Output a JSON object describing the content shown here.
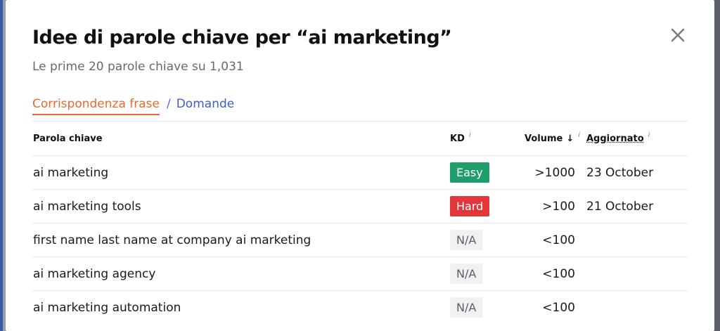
{
  "modal": {
    "title": "Idee di parole chiave per “ai marketing”",
    "subtitle": "Le prime 20 parole chiave su 1,031",
    "close_icon": "close-icon"
  },
  "tabs": {
    "active": "Corrispondenza frase",
    "separator": "/",
    "other": "Domande"
  },
  "table": {
    "headers": {
      "keyword": "Parola chiave",
      "kd": "KD",
      "volume": "Volume",
      "volume_sort_icon": "↓",
      "updated": "Aggiornato",
      "info_icon": "i"
    },
    "rows": [
      {
        "keyword": "ai marketing",
        "kd": "Easy",
        "kd_status": "easy",
        "volume": ">1000",
        "updated": "23 October"
      },
      {
        "keyword": "ai marketing tools",
        "kd": "Hard",
        "kd_status": "hard",
        "volume": ">100",
        "updated": "21 October"
      },
      {
        "keyword": "first name last name at company ai marketing",
        "kd": "N/A",
        "kd_status": "na",
        "volume": "<100",
        "updated": ""
      },
      {
        "keyword": "ai marketing agency",
        "kd": "N/A",
        "kd_status": "na",
        "volume": "<100",
        "updated": ""
      },
      {
        "keyword": "ai marketing automation",
        "kd": "N/A",
        "kd_status": "na",
        "volume": "<100",
        "updated": ""
      }
    ]
  },
  "colors": {
    "accent_orange": "#e8692d",
    "link_blue": "#3e5ccf",
    "easy_green": "#1f9d6b",
    "hard_red": "#e2363a",
    "na_gray": "#f0f1f2"
  }
}
